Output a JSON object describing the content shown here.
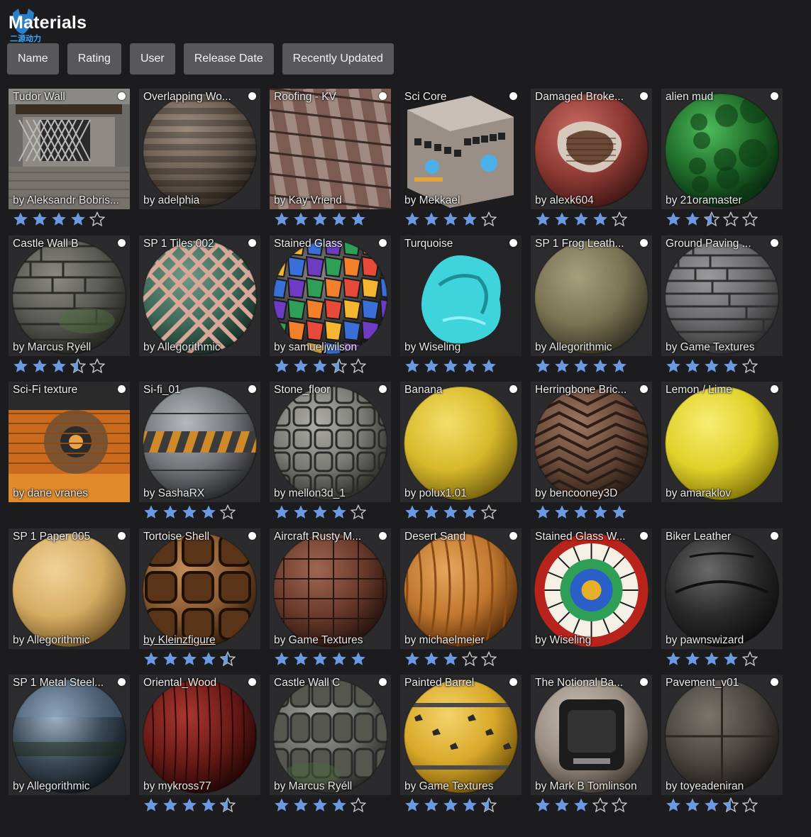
{
  "header": {
    "title": "Materials",
    "logo_text": "二源动力"
  },
  "sort_buttons": [
    "Name",
    "Rating",
    "User",
    "Release Date",
    "Recently Updated"
  ],
  "colors": {
    "background": "#1c1c1e",
    "button": "#58585a",
    "star_filled": "#6b9ae3",
    "star_empty": "#c8c8c8"
  },
  "materials": [
    {
      "name": "Tudor Wall",
      "author": "by Aleksandr Bobris...",
      "rating": 4,
      "thumb": "tudor",
      "icon": "dot-icon"
    },
    {
      "name": "Overlapping Wo...",
      "author": "by adelphia",
      "rating": null,
      "thumb": "wood-stack",
      "icon": "dot-icon"
    },
    {
      "name": "Roofing - KV",
      "author": "by Kay Vriend",
      "rating": 5,
      "thumb": "roof",
      "icon": "dot-icon"
    },
    {
      "name": "Sci Core",
      "author": "by Mekkael",
      "rating": 4,
      "thumb": "scicore",
      "icon": "dot-icon"
    },
    {
      "name": "Damaged Broke...",
      "author": "by alexk604",
      "rating": 4,
      "thumb": "damaged",
      "icon": "dot-icon"
    },
    {
      "name": "alien mud",
      "author": "by 21oramaster",
      "rating": 2.5,
      "thumb": "alien",
      "icon": "dot-icon"
    },
    {
      "name": "Castle Wall B",
      "author": "by Marcus Ryéll",
      "rating": 3.5,
      "thumb": "castle-b",
      "icon": "dot-icon"
    },
    {
      "name": "SP 1 Tiles 002",
      "author": "by Allegorithmic",
      "rating": null,
      "thumb": "tiles",
      "icon": "dot-icon"
    },
    {
      "name": "Stained Glass",
      "author": "by samueljwilson",
      "rating": 3.5,
      "thumb": "stained",
      "icon": "dot-icon"
    },
    {
      "name": "Turquoise",
      "author": "by Wiseling",
      "rating": 5,
      "thumb": "turquoise",
      "icon": "dot-icon"
    },
    {
      "name": "SP 1 Frog Leath...",
      "author": "by Allegorithmic",
      "rating": 5,
      "thumb": "frog",
      "icon": "dot-icon"
    },
    {
      "name": "Ground Paving ...",
      "author": "by Game Textures",
      "rating": 4,
      "thumb": "paving",
      "icon": "dot-icon"
    },
    {
      "name": "Sci-Fi texture",
      "author": "by dane vranes",
      "rating": null,
      "thumb": "scifi-tex",
      "icon": "dot-icon"
    },
    {
      "name": "Si-fi_01",
      "author": "by SashaRX",
      "rating": 4,
      "thumb": "sifi",
      "icon": "dot-icon"
    },
    {
      "name": "Stone_floor",
      "author": "by mellon3d_1",
      "rating": 4,
      "thumb": "stonefloor",
      "icon": "dot-icon"
    },
    {
      "name": "Banana",
      "author": "by polux1.01",
      "rating": 4,
      "thumb": "banana",
      "icon": "dot-icon"
    },
    {
      "name": "Herringbone Bric...",
      "author": "by bencooney3D",
      "rating": 5,
      "thumb": "herringbone",
      "icon": "dot-icon"
    },
    {
      "name": "Lemon / Lime",
      "author": "by amaraklov",
      "rating": null,
      "thumb": "lemon",
      "icon": "dot-icon"
    },
    {
      "name": "SP 1 Paper 005",
      "author": "by Allegorithmic",
      "rating": null,
      "thumb": "paper",
      "icon": "dot-icon"
    },
    {
      "name": "Tortoise Shell",
      "author": "by Kleinzfigure",
      "rating": 4.5,
      "thumb": "tortoise",
      "icon": "dot-icon",
      "link": true
    },
    {
      "name": "Aircraft Rusty M...",
      "author": "by Game Textures",
      "rating": 5,
      "thumb": "aircraft",
      "icon": "dot-icon"
    },
    {
      "name": "Desert Sand",
      "author": "by michaelmeier",
      "rating": 3,
      "thumb": "desert",
      "icon": "dot-icon"
    },
    {
      "name": "Stained Glass W...",
      "author": "by Wiseling",
      "rating": null,
      "thumb": "rose",
      "icon": "dot-icon"
    },
    {
      "name": "Biker Leather",
      "author": "by pawnswizard",
      "rating": 4,
      "thumb": "biker",
      "icon": "dot-icon"
    },
    {
      "name": "SP 1 Metal Steel...",
      "author": "by Allegorithmic",
      "rating": null,
      "thumb": "metal",
      "icon": "dot-icon"
    },
    {
      "name": "Oriental_Wood",
      "author": "by mykross77",
      "rating": 4.5,
      "thumb": "oriental",
      "icon": "dot-icon"
    },
    {
      "name": "Castle Wall C",
      "author": "by Marcus Ryéll",
      "rating": 4,
      "thumb": "castle-c",
      "icon": "dot-icon"
    },
    {
      "name": "Painted Barrel",
      "author": "by Game Textures",
      "rating": 4.5,
      "thumb": "barrel",
      "icon": "dot-icon"
    },
    {
      "name": "The Notional Ba...",
      "author": "by Mark B Tomlinson",
      "rating": 3,
      "thumb": "notional",
      "icon": "dot-icon"
    },
    {
      "name": "Pavement_v01",
      "author": "by toyeadeniran",
      "rating": 3.5,
      "thumb": "pavement",
      "icon": "dot-icon"
    }
  ]
}
